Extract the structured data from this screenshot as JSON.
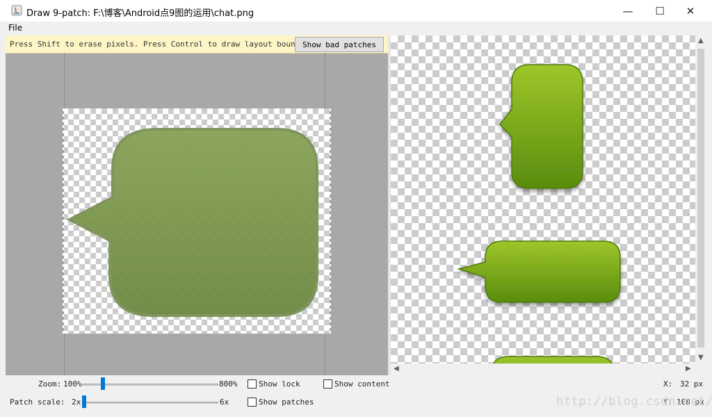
{
  "window": {
    "title": "Draw 9-patch: F:\\博客\\Android点9图的运用\\chat.png",
    "minimize": "—",
    "maximize": "☐",
    "close": "✕"
  },
  "menu": {
    "file": "File"
  },
  "editor": {
    "hint": "Press Shift to erase pixels. Press Control to draw layout bounds",
    "bad_patches_button": "Show bad patches"
  },
  "controls": {
    "zoom_label": "Zoom:",
    "zoom_min": "100%",
    "zoom_max": "800%",
    "zoom_value_fraction": 0.14,
    "patch_scale_label": "Patch scale:",
    "patch_min": "2x",
    "patch_max": "6x",
    "patch_value_fraction": 0.0,
    "show_lock": "Show lock",
    "show_content": "Show content",
    "show_patches": "Show patches",
    "x_label": "X:",
    "x_value": "32 px",
    "y_label": "Y:",
    "y_value": "108 px"
  },
  "watermark": "http://blog.csdn.net/",
  "colors": {
    "bubble_green_top": "#9ec62a",
    "bubble_green_bottom": "#5a8c0e",
    "editor_bubble": "#7e9b52",
    "slider_thumb": "#0078d7",
    "hint_bg": "#fdf5c6"
  }
}
